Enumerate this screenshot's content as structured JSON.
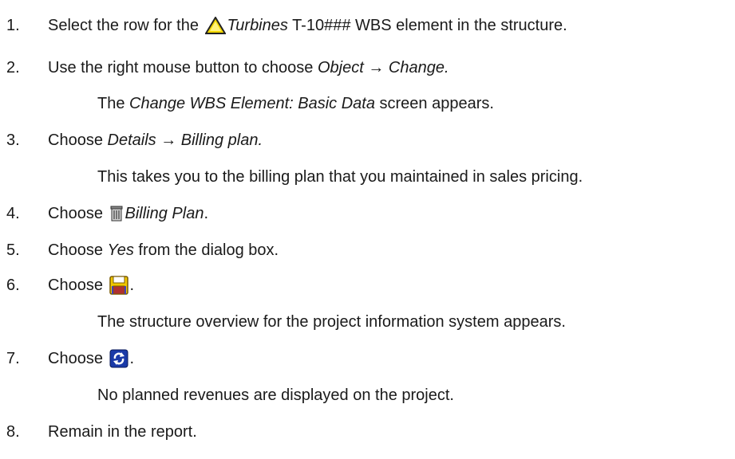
{
  "steps": [
    {
      "num": "1.",
      "a": "Select the row for the ",
      "icon": "warning-triangle-icon",
      "b_italic": "Turbines",
      "c": " T-10### WBS element in the structure."
    },
    {
      "num": "2.",
      "a": "Use the right mouse button to choose ",
      "b_italic": "Object",
      "arrow": " → ",
      "c_italic": "Change.",
      "note": {
        "a": "The ",
        "b_italic": "Change WBS Element: Basic Data",
        "c": " screen appears."
      }
    },
    {
      "num": "3.",
      "a": "Choose ",
      "b_italic": "Details",
      "arrow": " → ",
      "c_italic": "Billing plan.",
      "note": {
        "a": "This takes you to the billing plan that you maintained in sales pricing."
      }
    },
    {
      "num": "4.",
      "a": "Choose ",
      "icon": "trash-icon",
      "b_italic": "Billing Plan",
      "c": "."
    },
    {
      "num": "5.",
      "a": "Choose ",
      "b_italic": "Yes",
      "c": " from the dialog box."
    },
    {
      "num": "6.",
      "a": "Choose ",
      "icon": "save-icon",
      "c": ".",
      "note": {
        "a": "The structure overview for the project information system appears."
      }
    },
    {
      "num": "7.",
      "a": "Choose ",
      "icon": "refresh-icon",
      "c": ".",
      "note": {
        "a": "No planned revenues are displayed on the project."
      }
    },
    {
      "num": "8.",
      "a": "Remain in the report."
    }
  ],
  "colors": {
    "text": "#1a1a1a",
    "warning_fill": "#f2d600",
    "save_fill": "#f0c800",
    "refresh_fill": "#1a3aa8"
  }
}
